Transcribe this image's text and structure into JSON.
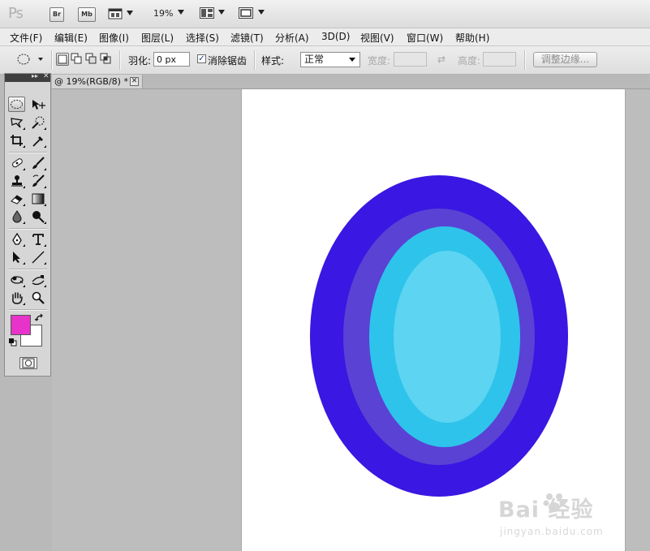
{
  "appbar": {
    "logo": "Ps",
    "bridge_label": "Br",
    "minibridge_label": "Mb",
    "zoom": "19%"
  },
  "menu": {
    "items": [
      "文件(F)",
      "编辑(E)",
      "图像(I)",
      "图层(L)",
      "选择(S)",
      "滤镜(T)",
      "分析(A)",
      "3D(D)",
      "视图(V)",
      "窗口(W)",
      "帮助(H)"
    ]
  },
  "options": {
    "feather_label": "羽化:",
    "feather_value": "0 px",
    "antialias_label": "消除锯齿",
    "antialias_checked": true,
    "style_label": "样式:",
    "style_value": "正常",
    "width_label": "宽度:",
    "height_label": "高度:",
    "swap_glyph": "⇄",
    "refine_edge_label": "调整边缘..."
  },
  "document": {
    "tab_title": "@ 19%(RGB/8) *",
    "close_glyph": "✕"
  },
  "artwork": {
    "rings_colors": [
      "#3a17e2",
      "#5a42d4",
      "#2ec3ea",
      "#5cd4f2"
    ]
  },
  "watermark": {
    "brand": "Bai 经验",
    "url": "jingyan.baidu.com"
  },
  "colors": {
    "foreground": "#e733c9",
    "background": "#ffffff",
    "toolbox_bg": "#d6d6d6",
    "canvas_bg": "#bdbdbd"
  },
  "toolbox": {
    "tools": [
      "rectangular-marquee-ellipse-icon",
      "move-icon",
      "lasso-icon",
      "quick-selection-icon",
      "crop-icon",
      "eyedropper-icon",
      "spot-healing-icon",
      "brush-icon",
      "clone-stamp-icon",
      "history-brush-icon",
      "eraser-icon",
      "gradient-icon",
      "blur-icon",
      "dodge-icon",
      "pen-icon",
      "type-icon",
      "path-selection-icon",
      "line-icon",
      "3d-rotate-icon",
      "3d-orbit-icon",
      "hand-icon",
      "zoom-icon"
    ]
  }
}
